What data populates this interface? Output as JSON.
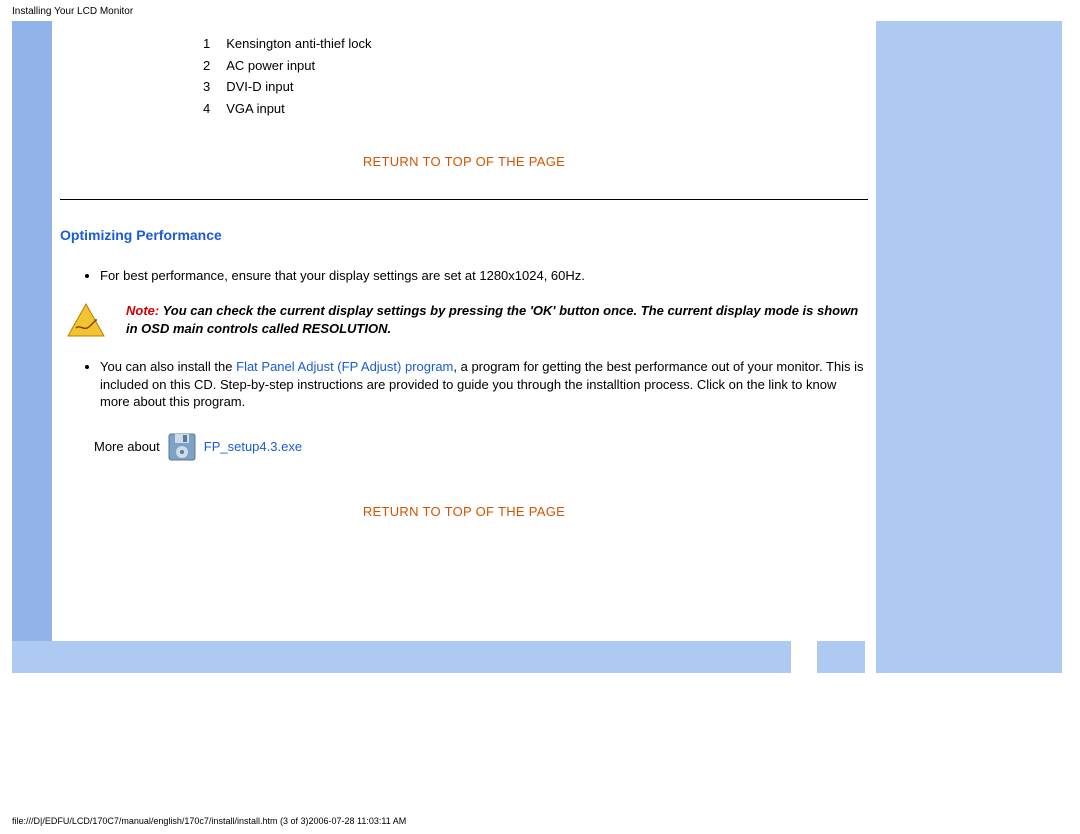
{
  "page_title": "Installing Your LCD Monitor",
  "ports": [
    {
      "num": "1",
      "label": "Kensington anti-thief lock"
    },
    {
      "num": "2",
      "label": "AC power input"
    },
    {
      "num": "3",
      "label": "DVI-D input"
    },
    {
      "num": "4",
      "label": "VGA input"
    }
  ],
  "return_link": "RETURN TO TOP OF THE PAGE",
  "section_heading": "Optimizing Performance",
  "bullet_perf": "For best performance, ensure that your display settings are set at 1280x1024, 60Hz.",
  "note_label": "Note:",
  "note_body": " You can check the current display settings by pressing the 'OK' button once. The current display mode is shown in OSD main controls called RESOLUTION.",
  "bullet_fp_pre": "You can also install the ",
  "fp_link": "Flat Panel Adjust (FP Adjust) program",
  "bullet_fp_post": ", a program for getting the best performance out of your monitor. This is included on this CD. Step-by-step instructions are provided to guide you through the installtion process. Click on the link to know more about this program.",
  "more_label": "More about",
  "exe_link": "FP_setup4.3.exe",
  "footer_path": "file:///D|/EDFU/LCD/170C7/manual/english/170c7/install/install.htm (3 of 3)2006-07-28 11:03:11 AM"
}
